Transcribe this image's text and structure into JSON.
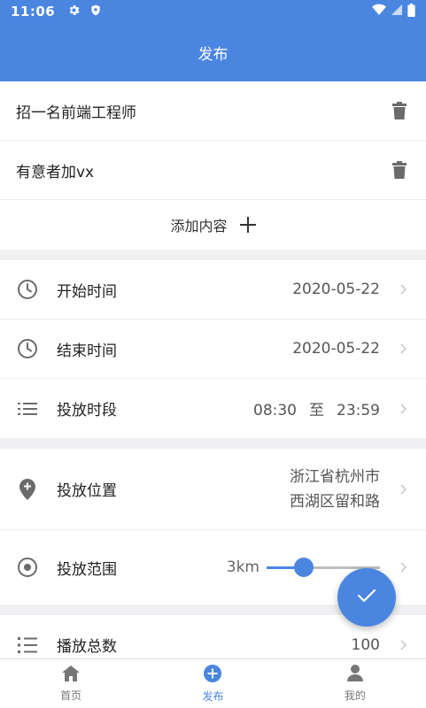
{
  "status_bar": {
    "time": "11:06"
  },
  "header": {
    "title": "发布"
  },
  "content_items": [
    {
      "text": "招一名前端工程师"
    },
    {
      "text": "有意者加vx"
    }
  ],
  "add_content_label": "添加内容",
  "fields": {
    "start_time": {
      "label": "开始时间",
      "value": "2020-05-22"
    },
    "end_time": {
      "label": "结束时间",
      "value": "2020-05-22"
    },
    "time_slot": {
      "label": "投放时段",
      "from": "08:30",
      "sep": "至",
      "to": "23:59"
    },
    "location": {
      "label": "投放位置",
      "line1": "浙江省杭州市",
      "line2": "西湖区留和路"
    },
    "range": {
      "label": "投放范围",
      "value_label": "3km",
      "level": 0.33
    },
    "total_plays": {
      "label": "播放总数",
      "value": "100"
    }
  },
  "tabs": [
    {
      "label": "首页",
      "icon": "home-icon"
    },
    {
      "label": "发布",
      "icon": "add-circle-icon",
      "active": true
    },
    {
      "label": "我的",
      "icon": "user-icon"
    }
  ],
  "colors": {
    "primary": "#4a86e0",
    "icon_gray": "#6b6b6b"
  }
}
